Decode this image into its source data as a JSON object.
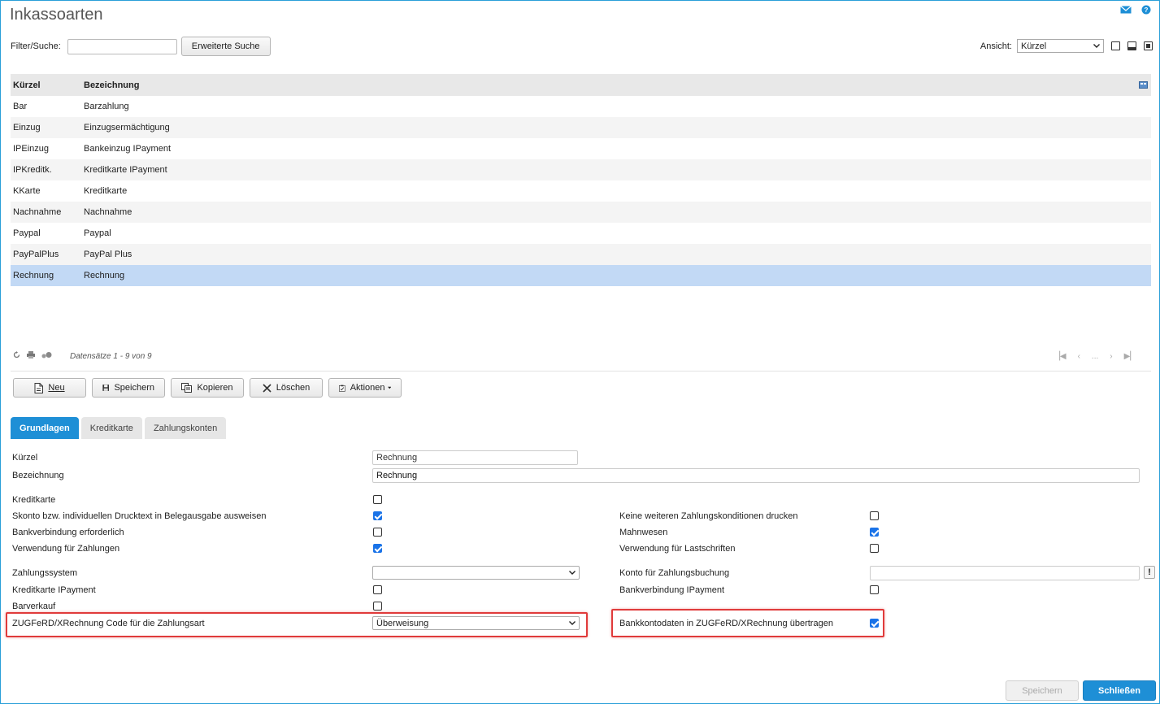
{
  "page": {
    "title": "Inkassoarten"
  },
  "filter": {
    "label": "Filter/Suche:",
    "value": "",
    "advanced_button": "Erweiterte Suche"
  },
  "view": {
    "label": "Ansicht:",
    "selected": "Kürzel"
  },
  "grid": {
    "columns": [
      "Kürzel",
      "Bezeichnung"
    ],
    "rows": [
      {
        "kuerzel": "Bar",
        "bezeichnung": "Barzahlung"
      },
      {
        "kuerzel": "Einzug",
        "bezeichnung": "Einzugsermächtigung"
      },
      {
        "kuerzel": "IPEinzug",
        "bezeichnung": "Bankeinzug IPayment"
      },
      {
        "kuerzel": "IPKreditk.",
        "bezeichnung": "Kreditkarte IPayment"
      },
      {
        "kuerzel": "KKarte",
        "bezeichnung": "Kreditkarte"
      },
      {
        "kuerzel": "Nachnahme",
        "bezeichnung": "Nachnahme"
      },
      {
        "kuerzel": "Paypal",
        "bezeichnung": "Paypal"
      },
      {
        "kuerzel": "PayPalPlus",
        "bezeichnung": "PayPal Plus"
      },
      {
        "kuerzel": "Rechnung",
        "bezeichnung": "Rechnung"
      }
    ],
    "selected_index": 8,
    "records_text": "Datensätze 1 - 9 von 9",
    "pager_ellipsis": "..."
  },
  "toolbar": {
    "neu": "Neu",
    "speichern": "Speichern",
    "kopieren": "Kopieren",
    "loeschen": "Löschen",
    "aktionen": "Aktionen"
  },
  "tabs": [
    "Grundlagen",
    "Kreditkarte",
    "Zahlungskonten"
  ],
  "form": {
    "kuerzel_label": "Kürzel",
    "kuerzel_value": "Rechnung",
    "bezeichnung_label": "Bezeichnung",
    "bezeichnung_value": "Rechnung",
    "kreditkarte_label": "Kreditkarte",
    "skonto_label": "Skonto bzw. individuellen Drucktext in Belegausgabe ausweisen",
    "bankverbindung_label": "Bankverbindung erforderlich",
    "verwendung_zahlungen_label": "Verwendung für Zahlungen",
    "keine_weiteren_label": "Keine weiteren Zahlungskonditionen drucken",
    "mahnwesen_label": "Mahnwesen",
    "verwendung_lastschriften_label": "Verwendung für Lastschriften",
    "zahlungssystem_label": "Zahlungssystem",
    "zahlungssystem_value": "",
    "konto_label": "Konto für Zahlungsbuchung",
    "konto_value": "",
    "kreditkarte_ipayment_label": "Kreditkarte IPayment",
    "bankverbindung_ipayment_label": "Bankverbindung IPayment",
    "barverkauf_label": "Barverkauf",
    "zugferd_code_label": "ZUGFeRD/XRechnung Code für die Zahlungsart",
    "zugferd_code_value": "Überweisung",
    "bankkontodaten_label": "Bankkontodaten in ZUGFeRD/XRechnung übertragen",
    "info_symbol": "!"
  },
  "footer": {
    "save": "Speichern",
    "close": "Schließen"
  },
  "colors": {
    "accent": "#1e8fd6",
    "selected_row": "#c2d9f5",
    "highlight": "#e03b3b"
  }
}
